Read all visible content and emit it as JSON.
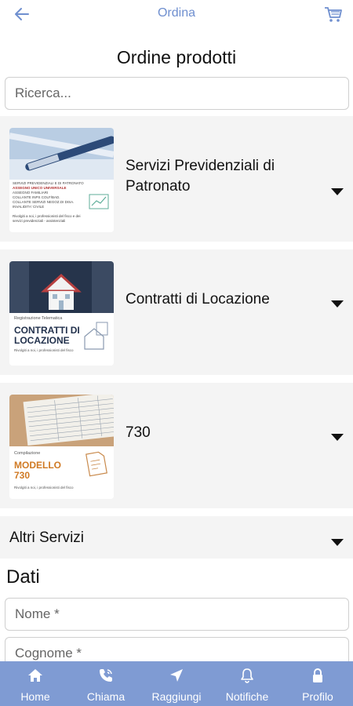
{
  "header": {
    "title": "Ordina",
    "back_icon": "arrow-left-icon",
    "cart_icon": "cart-icon"
  },
  "page": {
    "title": "Ordine prodotti"
  },
  "search": {
    "placeholder": "Ricerca..."
  },
  "products": [
    {
      "label": "Servizi Previdenziali di Patronato",
      "thumb": {
        "line1": "SERVIZI PREVIDENZIALI E DI PATRONATO",
        "line2": "ASSEGNO UNICO UNIVERSALE",
        "small": [
          "ASSEGNO FAMILIARI",
          "COLLANTE INPS COLF/BAD.",
          "COLLANTE SERVIZI NEGOZ.DI DISA.",
          "INVALIDITA' CIVILE"
        ],
        "footer": "Rivolgiti a noi, i professionisti del fisco e dei servizi previdenziali - assistenziali"
      }
    },
    {
      "label": "Contratti di Locazione",
      "thumb": {
        "top": "Registrazione Telematica",
        "big": "CONTRATTI DI LOCAZIONE",
        "footer": "Rivolgiti a noi, i professionisti del fisco"
      }
    },
    {
      "label": "730",
      "thumb": {
        "top": "Compilazione",
        "big": "MODELLO 730",
        "footer": "Rivolgiti a noi, i professionisti del fisco"
      }
    }
  ],
  "altri": {
    "label": "Altri Servizi"
  },
  "form": {
    "section_title": "Dati",
    "nome_placeholder": "Nome *",
    "cognome_placeholder": "Cognome *"
  },
  "tabbar": {
    "items": [
      {
        "label": "Home",
        "icon": "home-icon"
      },
      {
        "label": "Chiama",
        "icon": "phone-icon"
      },
      {
        "label": "Raggiungi",
        "icon": "navigation-arrow-icon"
      },
      {
        "label": "Notifiche",
        "icon": "bell-icon"
      },
      {
        "label": "Profilo",
        "icon": "lock-icon"
      }
    ]
  },
  "colors": {
    "accent": "#7f9bd3",
    "header_title": "#6f8fcf",
    "card_bg": "#f4f4f4"
  }
}
